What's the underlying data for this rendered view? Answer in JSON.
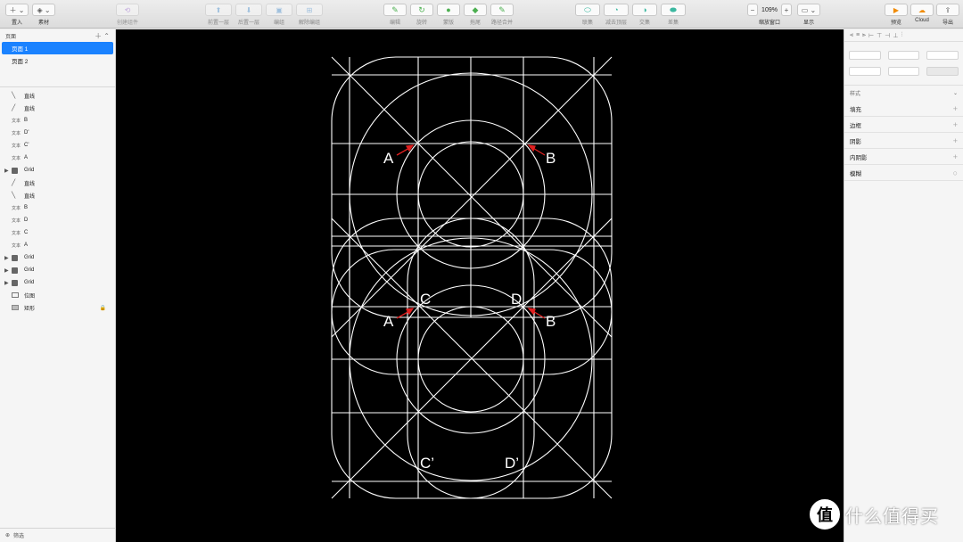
{
  "toolbar": {
    "insert_label": "置入",
    "material_label": "素材",
    "create_component_label": "创建组件",
    "group1": [
      "前置一层",
      "后置一层",
      "编组",
      "解除编组"
    ],
    "group2": [
      "编辑",
      "旋转",
      "蒙版",
      "拖尾",
      "路径合并"
    ],
    "group3": [
      "联集",
      "减去顶层",
      "交集",
      "差集"
    ],
    "zoom_value": "109%",
    "zoom_label": "缩放窗口",
    "display_label": "显示",
    "preview_label": "预览",
    "cloud_label": "Cloud",
    "export_label": "导出"
  },
  "left_panel": {
    "pages_header": "页面",
    "pages": [
      "页面 1",
      "页面 2"
    ],
    "layers": [
      {
        "type": "line",
        "name": "直线",
        "icon": "line-icon"
      },
      {
        "type": "line",
        "name": "直线",
        "icon": "line-icon"
      },
      {
        "type": "text",
        "name": "B",
        "tag": "文本"
      },
      {
        "type": "text",
        "name": "D'",
        "tag": "文本"
      },
      {
        "type": "text",
        "name": "C'",
        "tag": "文本"
      },
      {
        "type": "text",
        "name": "A",
        "tag": "文本"
      },
      {
        "type": "group",
        "name": "Grid"
      },
      {
        "type": "line",
        "name": "直线",
        "icon": "line-icon"
      },
      {
        "type": "line",
        "name": "直线",
        "icon": "line-icon"
      },
      {
        "type": "text",
        "name": "B",
        "tag": "文本"
      },
      {
        "type": "text",
        "name": "D",
        "tag": "文本"
      },
      {
        "type": "text",
        "name": "C",
        "tag": "文本"
      },
      {
        "type": "text",
        "name": "A",
        "tag": "文本"
      },
      {
        "type": "group",
        "name": "Grid"
      },
      {
        "type": "group",
        "name": "Grid"
      },
      {
        "type": "group",
        "name": "Grid"
      },
      {
        "type": "image",
        "name": "位图"
      },
      {
        "type": "rect",
        "name": "矩形",
        "locked": true
      }
    ],
    "filter_label": "筛选"
  },
  "canvas": {
    "labels": {
      "A_top": "A",
      "B_top": "B",
      "A_mid": "A",
      "B_mid": "B",
      "C_mid": "C",
      "D_mid": "D",
      "C_prime": "C’",
      "D_prime": "D’"
    },
    "line_color": "#ffffff",
    "arrow_color": "#e02020"
  },
  "right_panel": {
    "style_label": "样式",
    "properties": [
      "填充",
      "边框",
      "阴影",
      "内阴影",
      "模糊"
    ]
  },
  "watermark": {
    "badge": "值",
    "text": "什么值得买"
  }
}
